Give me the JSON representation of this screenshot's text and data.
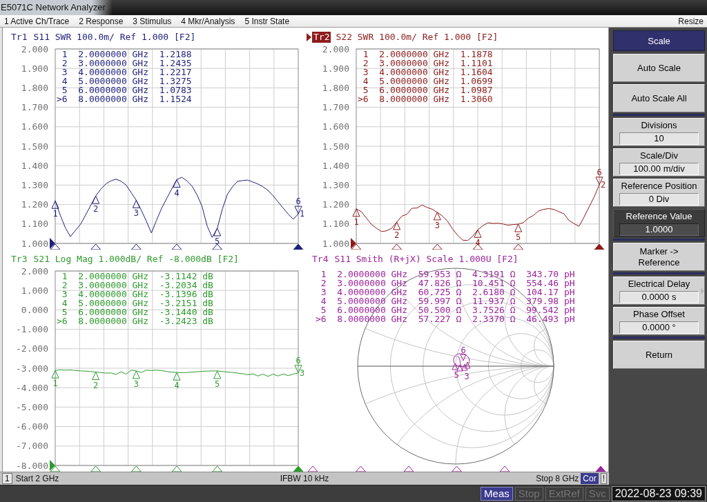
{
  "window": {
    "title": "E5071C Network Analyzer"
  },
  "menu": {
    "items": [
      "1 Active Ch/Trace",
      "2 Response",
      "3 Stimulus",
      "4 Mkr/Analysis",
      "5 Instr State"
    ],
    "resize": "Resize"
  },
  "traces": [
    {
      "kind": "rectangular",
      "tag": "Tr1",
      "selected": false,
      "header": "S11 SWR 100.0m/ Ref 1.000 [F2]",
      "color": "#1f1f7c",
      "end_label": "1",
      "marker_table": [
        {
          "id": "1",
          "stimulus": "2.0000000 GHz",
          "values": [
            "1.2188"
          ],
          "selected": false
        },
        {
          "id": "2",
          "stimulus": "3.0000000 GHz",
          "values": [
            "1.2435"
          ],
          "selected": false
        },
        {
          "id": "3",
          "stimulus": "4.0000000 GHz",
          "values": [
            "1.2217"
          ],
          "selected": false
        },
        {
          "id": "4",
          "stimulus": "5.0000000 GHz",
          "values": [
            "1.3275"
          ],
          "selected": false
        },
        {
          "id": "5",
          "stimulus": "6.0000000 GHz",
          "values": [
            "1.0783"
          ],
          "selected": false
        },
        {
          "id": ">6",
          "stimulus": "8.0000000 GHz",
          "values": [
            "1.1524"
          ],
          "selected": true
        }
      ],
      "chart_data": {
        "type": "line",
        "categories": [
          null,
          null,
          null,
          null,
          null,
          null,
          null,
          null,
          null,
          null,
          null,
          null,
          null,
          null,
          null,
          null,
          null,
          null,
          null,
          null,
          null,
          null,
          null,
          null,
          null,
          null,
          null,
          null,
          null,
          null,
          null,
          null,
          null,
          null,
          null,
          null,
          null,
          null,
          null,
          null,
          null,
          null,
          null,
          null,
          null,
          null,
          null,
          null,
          null
        ],
        "series": [
          {
            "color": "#1f1f7c",
            "values": [
              1.219,
              1.145,
              1.08,
              1.035,
              1.067,
              1.099,
              1.146,
              1.195,
              1.244,
              1.279,
              1.306,
              1.322,
              1.33,
              1.32,
              1.3,
              1.261,
              1.222,
              1.171,
              1.114,
              1.054,
              1.119,
              1.18,
              1.23,
              1.28,
              1.328,
              1.34,
              1.322,
              1.295,
              1.25,
              1.19,
              1.09,
              1.031,
              1.078,
              1.176,
              1.252,
              1.291,
              1.319,
              1.323,
              1.326,
              1.316,
              1.306,
              1.292,
              1.273,
              1.246,
              1.214,
              1.182,
              1.151,
              1.124,
              1.152
            ]
          }
        ],
        "ylim": [
          1,
          2
        ],
        "yticks": [
          {
            "value": 2,
            "label": "2.000"
          },
          {
            "value": 1.9,
            "label": "1.900"
          },
          {
            "value": 1.8,
            "label": "1.800"
          },
          {
            "value": 1.7,
            "label": "1.700"
          },
          {
            "value": 1.6,
            "label": "1.600"
          },
          {
            "value": 1.5,
            "label": "1.500"
          },
          {
            "value": 1.4,
            "label": "1.400"
          },
          {
            "value": 1.3,
            "label": "1.300"
          },
          {
            "value": 1.2,
            "label": "1.200"
          },
          {
            "value": 1.1,
            "label": "1.100"
          },
          {
            "value": 1,
            "label": "1.000"
          }
        ],
        "grid": true,
        "annotations": [
          "1",
          "2",
          "3",
          "4",
          "5",
          "6"
        ]
      }
    },
    {
      "kind": "rectangular",
      "tag": "Tr2",
      "selected": true,
      "header": "S22 SWR 100.0m/ Ref 1.000 [F2]",
      "color": "#8e1b1b",
      "end_label": "2",
      "marker_table": [
        {
          "id": "1",
          "stimulus": "2.0000000 GHz",
          "values": [
            "1.1878"
          ],
          "selected": false
        },
        {
          "id": "2",
          "stimulus": "3.0000000 GHz",
          "values": [
            "1.1101"
          ],
          "selected": false
        },
        {
          "id": "3",
          "stimulus": "4.0000000 GHz",
          "values": [
            "1.1604"
          ],
          "selected": false
        },
        {
          "id": "4",
          "stimulus": "5.0000000 GHz",
          "values": [
            "1.0699"
          ],
          "selected": false
        },
        {
          "id": "5",
          "stimulus": "6.0000000 GHz",
          "values": [
            "1.0987"
          ],
          "selected": false
        },
        {
          "id": ">6",
          "stimulus": "8.0000000 GHz",
          "values": [
            "1.3060"
          ],
          "selected": true
        }
      ],
      "chart_data": {
        "type": "line",
        "categories": [
          null,
          null,
          null,
          null,
          null,
          null,
          null,
          null,
          null,
          null,
          null,
          null,
          null,
          null,
          null,
          null,
          null,
          null,
          null,
          null,
          null,
          null,
          null,
          null,
          null,
          null,
          null,
          null,
          null,
          null,
          null,
          null,
          null,
          null,
          null,
          null,
          null,
          null,
          null,
          null,
          null,
          null,
          null,
          null,
          null,
          null,
          null,
          null,
          null
        ],
        "series": [
          {
            "color": "#8e1b1b",
            "values": [
              1.178,
              1.163,
              1.13,
              1.098,
              1.078,
              1.061,
              1.065,
              1.078,
              1.11,
              1.14,
              1.15,
              1.181,
              1.182,
              1.197,
              1.185,
              1.176,
              1.16,
              1.141,
              1.115,
              1.076,
              1.042,
              1.017,
              1.015,
              1.037,
              1.07,
              1.091,
              1.106,
              1.103,
              1.104,
              1.1,
              1.094,
              1.097,
              1.099,
              1.107,
              1.13,
              1.144,
              1.167,
              1.175,
              1.179,
              1.175,
              1.163,
              1.153,
              1.118,
              1.102,
              1.088,
              1.136,
              1.188,
              1.24,
              1.302
            ]
          }
        ],
        "ylim": [
          1,
          2
        ],
        "yticks": [
          {
            "value": 2,
            "label": "2.000"
          },
          {
            "value": 1.9,
            "label": "1.900"
          },
          {
            "value": 1.8,
            "label": "1.800"
          },
          {
            "value": 1.7,
            "label": "1.700"
          },
          {
            "value": 1.6,
            "label": "1.600"
          },
          {
            "value": 1.5,
            "label": "1.500"
          },
          {
            "value": 1.4,
            "label": "1.400"
          },
          {
            "value": 1.3,
            "label": "1.300"
          },
          {
            "value": 1.2,
            "label": "1.200"
          },
          {
            "value": 1.1,
            "label": "1.100"
          },
          {
            "value": 1,
            "label": "1.000"
          }
        ],
        "grid": true,
        "annotations": [
          "1",
          "2",
          "3",
          "4",
          "5",
          "6"
        ]
      }
    },
    {
      "kind": "rectangular",
      "tag": "Tr3",
      "selected": false,
      "header": "S21 Log Mag 1.000dB/ Ref -8.000dB [F2]",
      "color": "#2e9a2e",
      "end_label": "3",
      "marker_table": [
        {
          "id": "1",
          "stimulus": "2.0000000 GHz",
          "values": [
            "-3.1142 dB"
          ],
          "selected": false
        },
        {
          "id": "2",
          "stimulus": "3.0000000 GHz",
          "values": [
            "-3.2034 dB"
          ],
          "selected": false
        },
        {
          "id": "3",
          "stimulus": "4.0000000 GHz",
          "values": [
            "-3.1396 dB"
          ],
          "selected": false
        },
        {
          "id": "4",
          "stimulus": "5.0000000 GHz",
          "values": [
            "-3.2151 dB"
          ],
          "selected": false
        },
        {
          "id": "5",
          "stimulus": "6.0000000 GHz",
          "values": [
            "-3.1440 dB"
          ],
          "selected": false
        },
        {
          "id": ">6",
          "stimulus": "8.0000000 GHz",
          "values": [
            "-3.2423 dB"
          ],
          "selected": true
        }
      ],
      "chart_data": {
        "type": "line",
        "categories": [
          null,
          null,
          null,
          null,
          null,
          null,
          null,
          null,
          null,
          null,
          null,
          null,
          null,
          null,
          null,
          null,
          null,
          null,
          null,
          null,
          null,
          null,
          null,
          null,
          null,
          null,
          null,
          null,
          null,
          null,
          null,
          null,
          null,
          null,
          null,
          null,
          null,
          null,
          null,
          null,
          null,
          null,
          null,
          null,
          null,
          null,
          null,
          null,
          null
        ],
        "series": [
          {
            "color": "#2e9a2e",
            "values": [
              -3.11,
              -3.08,
              -3.1,
              -3.09,
              -3.12,
              -3.14,
              -3.15,
              -3.17,
              -3.2,
              -3.22,
              -3.25,
              -3.24,
              -3.32,
              -3.18,
              -3.3,
              -3.1,
              -3.14,
              -3.22,
              -3.1,
              -3.12,
              -3.1,
              -3.12,
              -3.17,
              -3.2,
              -3.22,
              -3.23,
              -3.22,
              -3.2,
              -3.18,
              -3.16,
              -3.15,
              -3.14,
              -3.14,
              -3.17,
              -3.19,
              -3.22,
              -3.25,
              -3.28,
              -3.34,
              -3.29,
              -3.4,
              -3.3,
              -3.42,
              -3.3,
              -3.4,
              -3.3,
              -3.38,
              -3.3,
              -3.24
            ]
          }
        ],
        "ylim": [
          -8,
          2
        ],
        "yticks": [
          {
            "value": 2,
            "label": "2.000"
          },
          {
            "value": 1,
            "label": "1.000"
          },
          {
            "value": 0,
            "label": "0.000"
          },
          {
            "value": -1,
            "label": "-1.000"
          },
          {
            "value": -2,
            "label": "-2.000"
          },
          {
            "value": -3,
            "label": "-3.000"
          },
          {
            "value": -4,
            "label": "-4.000"
          },
          {
            "value": -5,
            "label": "-5.000"
          },
          {
            "value": -6,
            "label": "-6.000"
          },
          {
            "value": -7,
            "label": "-7.000"
          },
          {
            "value": -8,
            "label": "-8.000"
          }
        ],
        "grid": true,
        "annotations": [
          "1",
          "2",
          "3",
          "4",
          "5",
          "6"
        ]
      }
    },
    {
      "kind": "smith",
      "tag": "Tr4",
      "selected": false,
      "header": "S11 Smith (R+jX) Scale 1.000U [F2]",
      "color": "#9c249c",
      "marker_table": [
        {
          "id": "1",
          "stimulus": "2.0000000 GHz",
          "values": [
            "59.953 Ω",
            "4.3191 Ω",
            "343.70 pH"
          ],
          "selected": false
        },
        {
          "id": "2",
          "stimulus": "3.0000000 GHz",
          "values": [
            "47.826 Ω",
            "10.451 Ω",
            "554.46 pH"
          ],
          "selected": false
        },
        {
          "id": "3",
          "stimulus": "4.0000000 GHz",
          "values": [
            "60.725 Ω",
            "2.6180 Ω",
            "104.17 pH"
          ],
          "selected": false
        },
        {
          "id": "4",
          "stimulus": "5.0000000 GHz",
          "values": [
            "59.997 Ω",
            "11.937 Ω",
            "379.98 pH"
          ],
          "selected": false
        },
        {
          "id": "5",
          "stimulus": "6.0000000 GHz",
          "values": [
            "50.500 Ω",
            "3.7526 Ω",
            "99.542 pH"
          ],
          "selected": false
        },
        {
          "id": ">6",
          "stimulus": "8.0000000 GHz",
          "values": [
            "57.227 Ω",
            "2.3370 Ω",
            "46.493 pH"
          ],
          "selected": true
        }
      ],
      "marker_labels": [
        "6",
        "5",
        "3"
      ]
    }
  ],
  "channel_bar": {
    "channel": "1",
    "start": "Start 2 GHz",
    "ifbw": "IFBW 10 kHz",
    "stop": "Stop 8 GHz",
    "correction": "Cor",
    "warning": "!"
  },
  "softkeys": {
    "title": "Scale",
    "groups": [
      [
        {
          "kind": "button",
          "label": "Auto Scale",
          "selected": false,
          "submenu": false
        },
        {
          "kind": "button",
          "label": "Auto Scale All",
          "selected": false,
          "submenu": false
        }
      ],
      [
        {
          "kind": "field",
          "label": "Divisions",
          "value": "10",
          "selected": false,
          "submenu": false
        },
        {
          "kind": "field",
          "label": "Scale/Div",
          "value": "100.00 m/div",
          "selected": false,
          "submenu": false
        },
        {
          "kind": "field",
          "label": "Reference Position",
          "value": "0 Div",
          "selected": false,
          "submenu": false
        },
        {
          "kind": "field",
          "label": "Reference Value",
          "value": "1.0000",
          "selected": true,
          "submenu": false
        }
      ],
      [
        {
          "kind": "button",
          "label": "Marker -> Reference",
          "selected": false,
          "submenu": false
        }
      ],
      [
        {
          "kind": "field",
          "label": "Electrical Delay",
          "value": "0.0000 s",
          "selected": false,
          "submenu": true
        },
        {
          "kind": "field",
          "label": "Phase Offset",
          "value": "0.0000 °",
          "selected": false,
          "submenu": false
        }
      ],
      [
        {
          "kind": "button",
          "label": "Return",
          "selected": false,
          "submenu": false
        }
      ]
    ]
  },
  "status": {
    "indicators": [
      {
        "label": "Meas",
        "on": true
      },
      {
        "label": "Stop",
        "on": false
      },
      {
        "label": "ExtRef",
        "on": false
      },
      {
        "label": "Svc",
        "on": false
      }
    ],
    "datetime": "2022-08-23 09:39"
  }
}
